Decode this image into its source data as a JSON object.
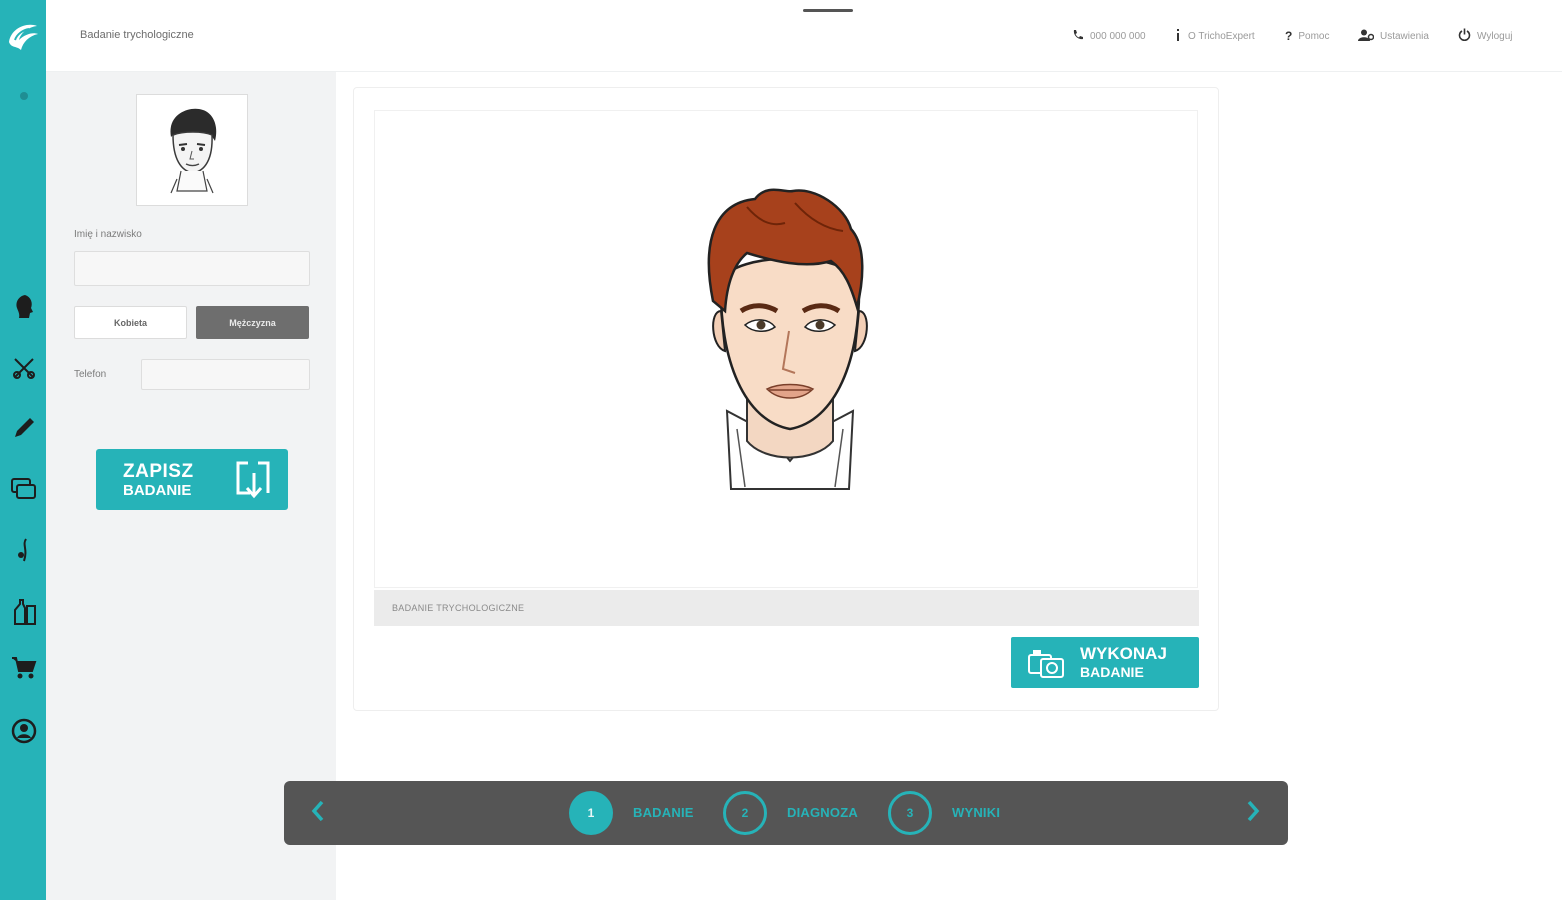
{
  "app": {
    "page_title": "Badanie trychologiczne"
  },
  "topnav": {
    "phone": "000 000 000",
    "about": "O TrichoExpert",
    "help": "Pomoc",
    "settings": "Ustawienia",
    "logout": "Wyloguj"
  },
  "patient": {
    "name_label": "Imię i nazwisko",
    "name_value": "",
    "gender_female": "Kobieta",
    "gender_male": "Mężczyzna",
    "gender_selected": "Mężczyzna",
    "phone_label": "Telefon",
    "phone_value": ""
  },
  "save": {
    "line1": "ZAPISZ",
    "line2": "BADANIE"
  },
  "exam": {
    "caption": "BADANIE TRYCHOLOGICZNE",
    "run_line1": "WYKONAJ",
    "run_line2": "BADANIE"
  },
  "steps": [
    {
      "number": "1",
      "label": "BADANIE",
      "active": true
    },
    {
      "number": "2",
      "label": "DIAGNOZA",
      "active": false
    },
    {
      "number": "3",
      "label": "WYNIKI",
      "active": false
    }
  ],
  "colors": {
    "accent": "#26b3b8",
    "stepper_bg": "#555555",
    "panel_bg": "#f2f3f4",
    "hair": "#a7411c"
  },
  "icons": {
    "sidebar": [
      "head-profile-icon",
      "scissors-icon",
      "pencil-icon",
      "layers-icon",
      "hair-strand-icon",
      "products-icon",
      "cart-icon",
      "user-circle-icon"
    ]
  }
}
